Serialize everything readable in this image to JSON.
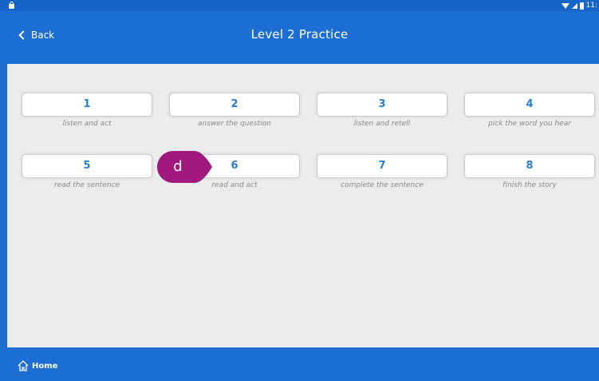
{
  "status_bar": {
    "time": "11:",
    "icons": [
      "lock-icon",
      "wifi-icon",
      "signal-icon",
      "battery-icon"
    ]
  },
  "header": {
    "back_label": "Back",
    "title": "Level 2 Practice"
  },
  "exercises": [
    {
      "number": "1",
      "caption": "listen and act"
    },
    {
      "number": "2",
      "caption": "answer the question"
    },
    {
      "number": "3",
      "caption": "listen and retell"
    },
    {
      "number": "4",
      "caption": "pick the word you hear"
    },
    {
      "number": "5",
      "caption": "read the sentence"
    },
    {
      "number": "6",
      "caption": "read and act"
    },
    {
      "number": "7",
      "caption": "complete the sentence"
    },
    {
      "number": "8",
      "caption": "finish the story"
    }
  ],
  "pointer_marker": {
    "label": "d",
    "color": "#a0197f"
  },
  "footer": {
    "home_label": "Home"
  },
  "colors": {
    "primary": "#1c6ed2",
    "number_text": "#2a7dcf",
    "caption_text": "#8a8a8a",
    "content_bg": "#ececec"
  }
}
